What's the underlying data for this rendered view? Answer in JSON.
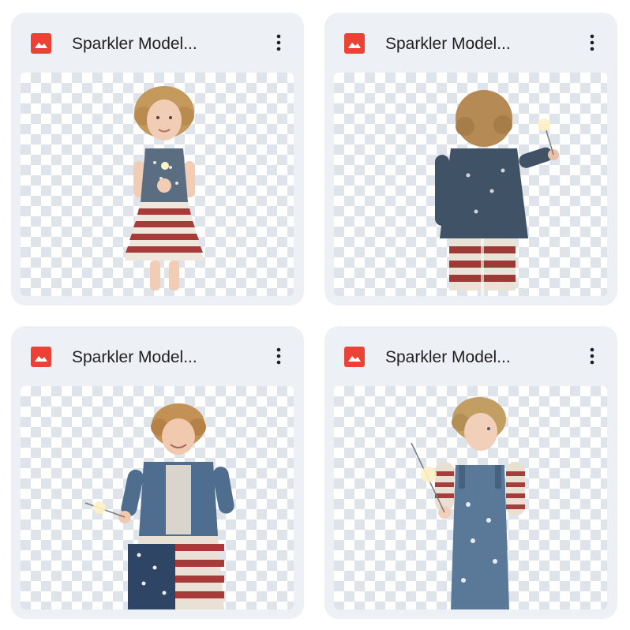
{
  "files": [
    {
      "title": "Sparkler Model...",
      "icon": "image-file-icon",
      "menu_icon": "more-vert-icon",
      "subject": "girl-in-flag-dress"
    },
    {
      "title": "Sparkler Model...",
      "icon": "image-file-icon",
      "menu_icon": "more-vert-icon",
      "subject": "child-back-with-sparkler"
    },
    {
      "title": "Sparkler Model...",
      "icon": "image-file-icon",
      "menu_icon": "more-vert-icon",
      "subject": "boy-denim-jacket-sparkler"
    },
    {
      "title": "Sparkler Model...",
      "icon": "image-file-icon",
      "menu_icon": "more-vert-icon",
      "subject": "boy-overalls-sparkler"
    }
  ],
  "colors": {
    "card_bg": "#edf0f5",
    "icon_red": "#ea4335",
    "checker": "#dfe3ea",
    "text": "#1f1f1f"
  }
}
